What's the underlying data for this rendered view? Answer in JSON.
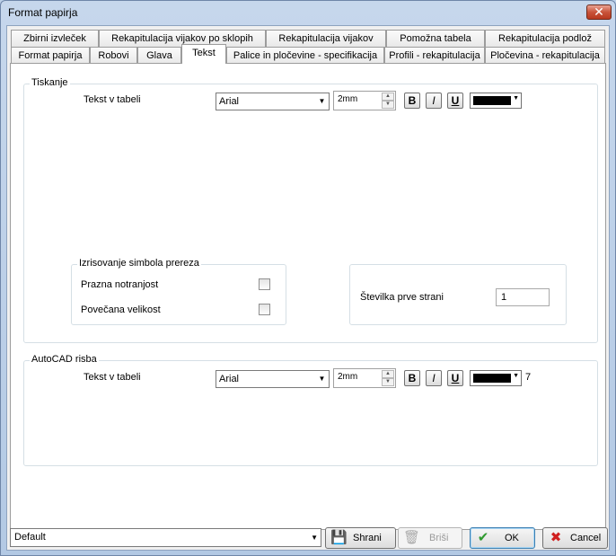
{
  "window": {
    "title": "Format papirja",
    "close_glyph": "✕"
  },
  "tabs_row1": [
    {
      "label": "Zbirni izvleček"
    },
    {
      "label": "Rekapitulacija vijakov po sklopih"
    },
    {
      "label": "Rekapitulacija vijakov"
    },
    {
      "label": "Pomožna tabela"
    },
    {
      "label": "Rekapitulacija podlož"
    }
  ],
  "tabs_row2": [
    {
      "label": "Format papirja"
    },
    {
      "label": "Robovi"
    },
    {
      "label": "Glava"
    },
    {
      "label": "Tekst",
      "active": true
    },
    {
      "label": "Palice in pločevine - specifikacija"
    },
    {
      "label": "Profili - rekapitulacija"
    },
    {
      "label": "Pločevina - rekapitulacija"
    }
  ],
  "tiskanje": {
    "title": "Tiskanje",
    "row_label": "Tekst v tabeli",
    "font": "Arial",
    "size": "2mm",
    "bold_label": "B",
    "italic_label": "I",
    "underline_label": "U",
    "color": "#000000",
    "simboli": {
      "title": "Izrisovanje simbola prereza",
      "prazna_label": "Prazna notranjost",
      "prazna_checked": false,
      "povecana_label": "Povečana velikost",
      "povecana_checked": false
    },
    "stevilka_label": "Številka prve strani",
    "stevilka_value": "1"
  },
  "autocad": {
    "title": "AutoCAD risba",
    "row_label": "Tekst v tabeli",
    "font": "Arial",
    "size": "2mm",
    "bold_label": "B",
    "italic_label": "I",
    "underline_label": "U",
    "color": "#000000",
    "color_index": "7"
  },
  "footer": {
    "preset": "Default",
    "save_label": "Shrani",
    "delete_label": "Briši",
    "ok_label": "OK",
    "cancel_label": "Cancel"
  },
  "icons": {
    "close": "close-icon",
    "save": "floppy-disk-icon",
    "delete": "trash-icon",
    "ok": "checkmark-icon",
    "cancel": "x-mark-icon"
  }
}
